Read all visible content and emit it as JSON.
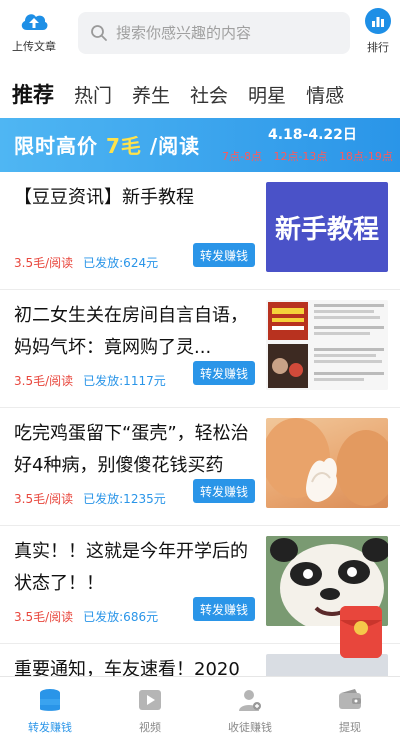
{
  "header": {
    "upload_label": "上传文章",
    "search_placeholder": "搜索你感兴趣的内容",
    "rank_label": "排行"
  },
  "tabs": [
    "推荐",
    "热门",
    "养生",
    "社会",
    "明星",
    "情感"
  ],
  "banner": {
    "title_prefix": "限时高价",
    "title_price": "7毛",
    "title_suffix": "/阅读",
    "date": "4.18-4.22日",
    "times": [
      "7点-8点",
      "12点-13点",
      "18点-19点"
    ]
  },
  "articles": [
    {
      "title": "【豆豆资讯】新手教程",
      "price": "3.5毛/阅读",
      "sent": "已发放:624元",
      "share_label": "转发赚钱",
      "thumb_text": "新手教程"
    },
    {
      "title": "初二女生关在房间自言自语，妈妈气坏：竟网购了灵...",
      "price": "3.5毛/阅读",
      "sent": "已发放:1117元",
      "share_label": "转发赚钱"
    },
    {
      "title": "吃完鸡蛋留下“蛋壳”，轻松治好4种病，别傻傻花钱买药",
      "price": "3.5毛/阅读",
      "sent": "已发放:1235元",
      "share_label": "转发赚钱"
    },
    {
      "title": "真实！！这就是今年开学后的状态了！！",
      "price": "3.5毛/阅读",
      "sent": "已发放:686元",
      "share_label": "转发赚钱"
    },
    {
      "title": "重要通知，车友速看！2020"
    }
  ],
  "bottom_nav": [
    {
      "label": "转发赚钱",
      "icon": "coins-icon",
      "active": true
    },
    {
      "label": "视频",
      "icon": "video-icon",
      "active": false
    },
    {
      "label": "收徒赚钱",
      "icon": "user-add-icon",
      "active": false
    },
    {
      "label": "提现",
      "icon": "wallet-icon",
      "active": false
    }
  ],
  "colors": {
    "accent": "#2a95e8",
    "price": "#e8463c",
    "banner_highlight": "#ffe24a"
  }
}
